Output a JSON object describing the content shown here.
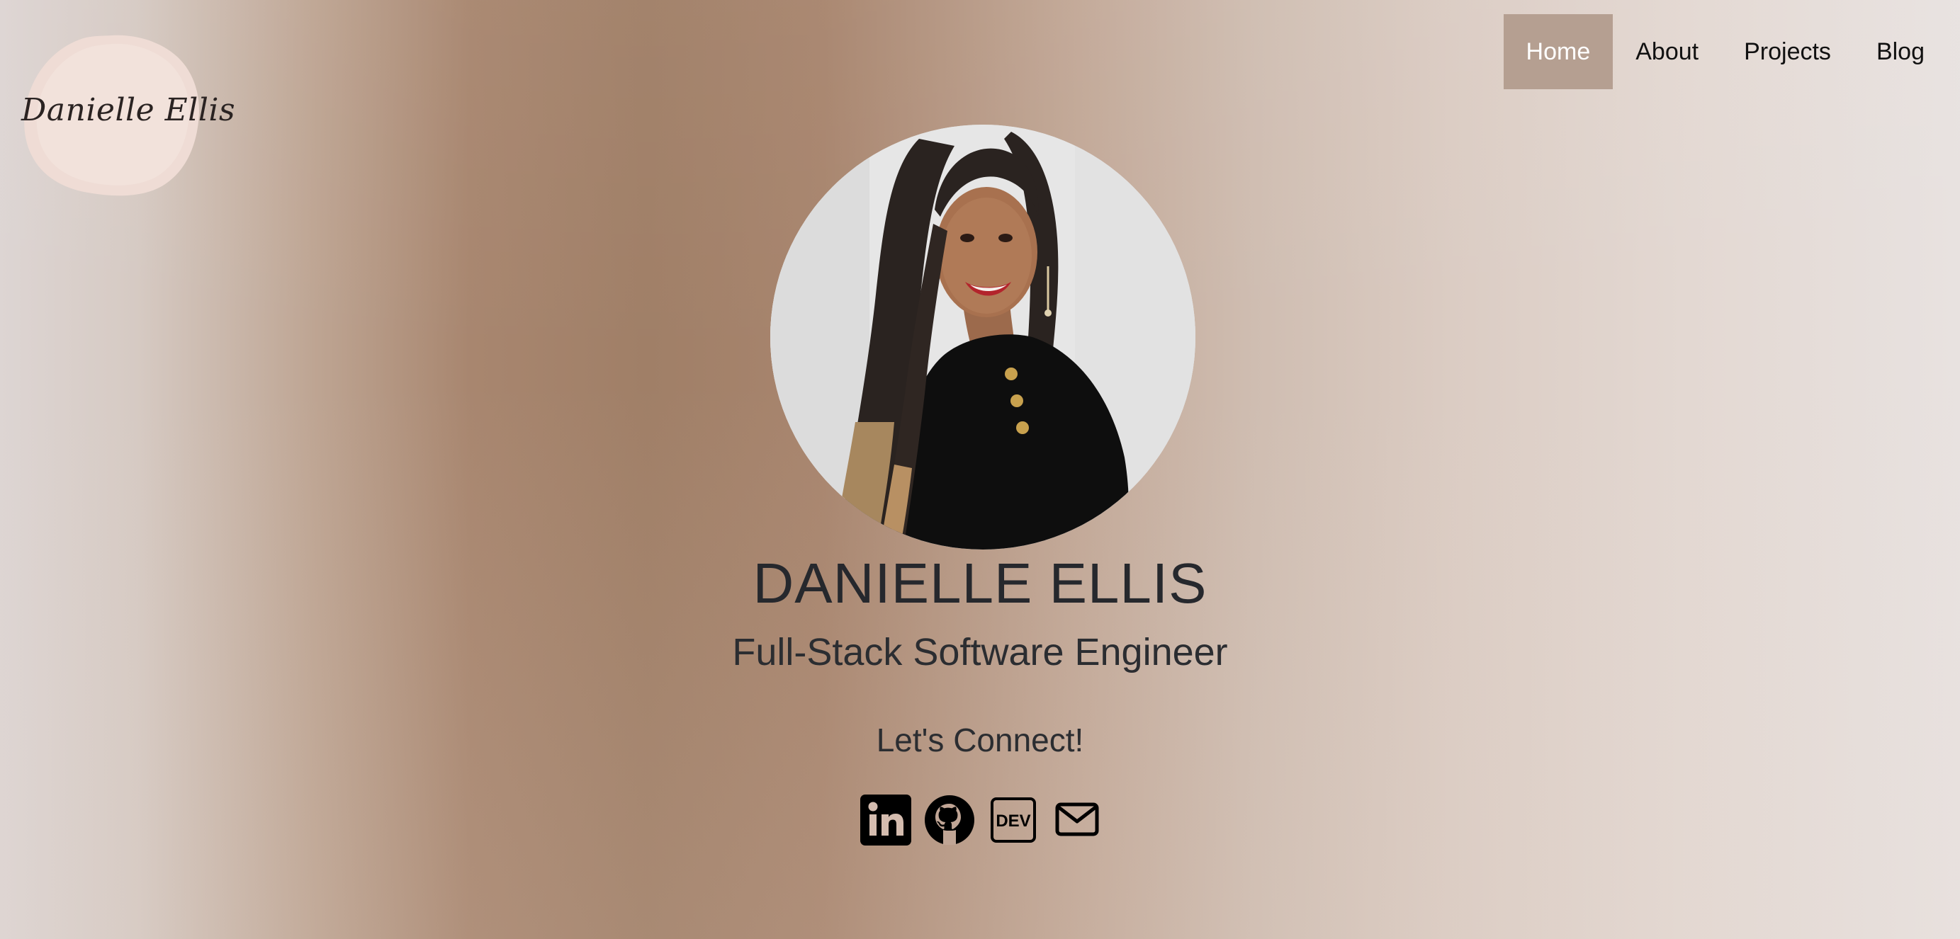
{
  "logo": {
    "text": "Danielle Ellis"
  },
  "nav": {
    "items": [
      {
        "label": "Home",
        "active": true
      },
      {
        "label": "About",
        "active": false
      },
      {
        "label": "Projects",
        "active": false
      },
      {
        "label": "Blog",
        "active": false
      }
    ]
  },
  "hero": {
    "name": "DANIELLE ELLIS",
    "title": "Full-Stack Software Engineer",
    "connect_heading": "Let's Connect!"
  },
  "socials": [
    {
      "icon": "linkedin-icon"
    },
    {
      "icon": "github-icon"
    },
    {
      "icon": "dev-icon",
      "label": "DEV"
    },
    {
      "icon": "mail-icon"
    }
  ],
  "colors": {
    "nav_active_bg": "#b59f91",
    "logo_blob": "#f0ddd6",
    "text_dark": "#26282d"
  }
}
